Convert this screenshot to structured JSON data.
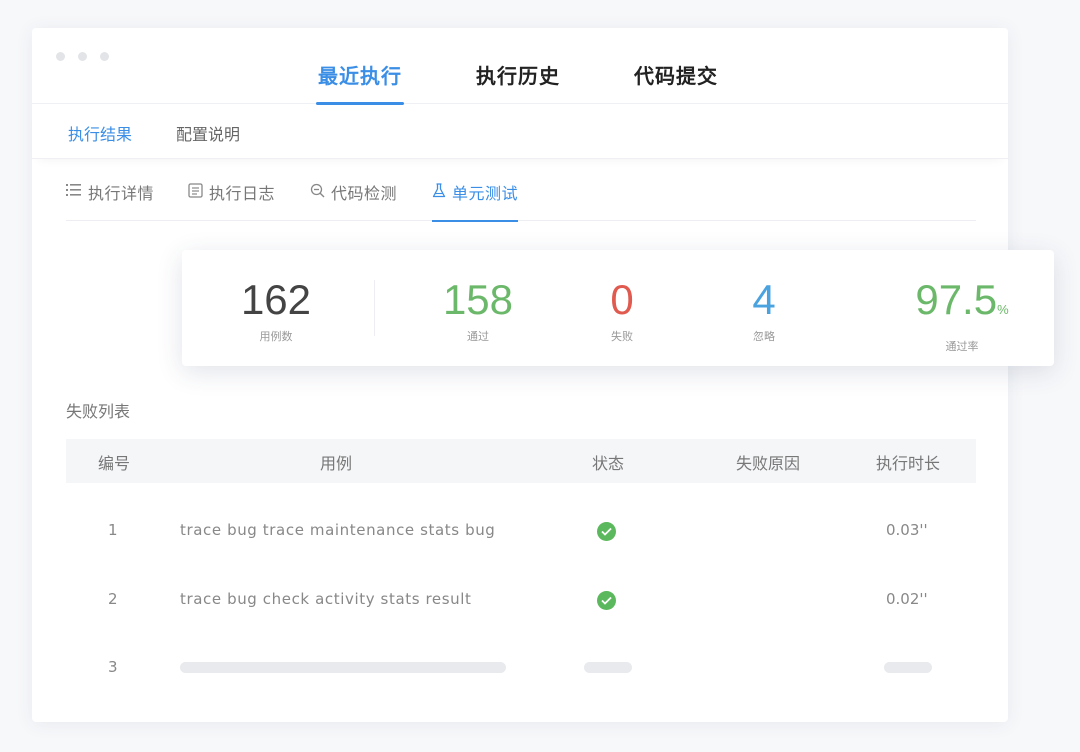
{
  "top_tabs": [
    "最近执行",
    "执行历史",
    "代码提交"
  ],
  "sub_tabs": [
    "执行结果",
    "配置说明"
  ],
  "inner_tabs": [
    {
      "label": "执行详情",
      "icon": "list-icon"
    },
    {
      "label": "执行日志",
      "icon": "log-icon"
    },
    {
      "label": "代码检测",
      "icon": "search-minus-icon"
    },
    {
      "label": "单元测试",
      "icon": "flask-icon"
    }
  ],
  "stats": {
    "total": {
      "value": "162",
      "label": "用例数"
    },
    "passed": {
      "value": "158",
      "label": "通过"
    },
    "failed": {
      "value": "0",
      "label": "失败"
    },
    "ignored": {
      "value": "4",
      "label": "忽略"
    },
    "pass_rate": {
      "value": "97.5",
      "unit": "%",
      "label": "通过率"
    }
  },
  "colors": {
    "accent": "#3a8ee6",
    "success": "#6cb86a",
    "danger": "#e05a4f",
    "info": "#4aa3df",
    "neutral": "#444444"
  },
  "failure_list": {
    "title": "失败列表",
    "columns": [
      "编号",
      "用例",
      "状态",
      "失败原因",
      "执行时长"
    ],
    "rows": [
      {
        "id": "1",
        "case": "trace bug trace maintenance stats bug",
        "status": "check-circle-icon",
        "duration": "0.03''"
      },
      {
        "id": "2",
        "case": "trace bug check activity stats result",
        "status": "check-circle-icon",
        "duration": "0.02''"
      },
      {
        "id": "3"
      }
    ]
  }
}
